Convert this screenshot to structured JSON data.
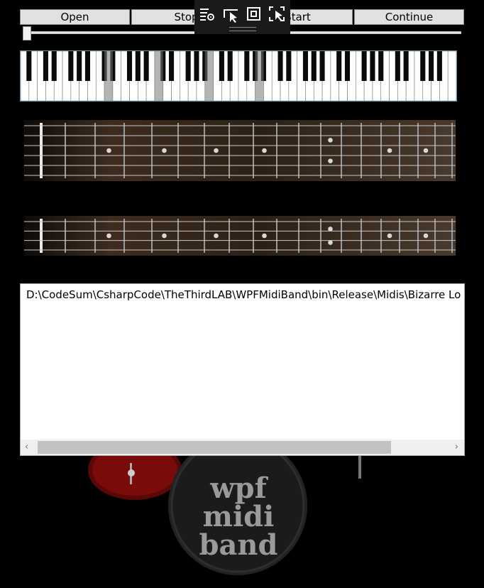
{
  "toolbar": {
    "open_label": "Open",
    "stop_label": "Stop",
    "start_label": "Start",
    "continue_label": "Continue"
  },
  "playback": {
    "progress": 0.0
  },
  "overlay_toolbar": {
    "icons": [
      "settings-list-icon",
      "select-cursor-icon",
      "fullscreen-icon",
      "screenshot-select-icon"
    ]
  },
  "log": {
    "path": "D:\\CodeSum\\CsharpCode\\TheThirdLAB\\WPFMidiBand\\bin\\Release\\Midis\\Bizarre Love"
  },
  "drum": {
    "label_line1": "wpf midi",
    "label_line2": "band"
  },
  "colors": {
    "button_bg": "#e1e1e1",
    "fretboard_wood": "#3a2a1e",
    "drum_shell": "#7a0b0b"
  }
}
